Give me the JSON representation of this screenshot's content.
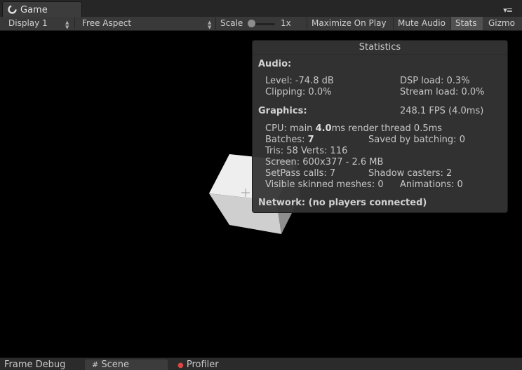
{
  "tab": {
    "icon": "unity-logo-icon",
    "label": "Game"
  },
  "panel_menu": {
    "icon": "panel-menu-icon",
    "glyph": "▾≡"
  },
  "toolbar": {
    "display": "Display 1",
    "aspect": "Free Aspect",
    "scale_label": "Scale",
    "scale_value": "1x",
    "maximize": "Maximize On Play",
    "mute": "Mute Audio",
    "stats": "Stats",
    "gizmos": "Gizmo"
  },
  "stats": {
    "title": "Statistics",
    "audio_header": "Audio:",
    "level": "Level: -74.8 dB",
    "dsp_load": "DSP load: 0.3%",
    "clipping": "Clipping: 0.0%",
    "stream_load": "Stream load: 0.0%",
    "graphics_header": "Graphics:",
    "fps": "248.1 FPS (4.0ms)",
    "cpu_prefix": "CPU: main ",
    "cpu_main": "4.0",
    "cpu_suffix": "ms  render thread 0.5ms",
    "batches_prefix": "Batches: ",
    "batches": "7",
    "saved_batching": "Saved by batching: 0",
    "tris_verts": "Tris: 58   Verts: 116",
    "screen": "Screen: 600x377 - 2.6 MB",
    "setpass": "SetPass calls: 7",
    "shadow_casters": "Shadow casters: 2",
    "skinned_meshes": "Visible skinned meshes: 0",
    "animations": "Animations: 0",
    "network": "Network: (no players connected)"
  },
  "bottom_tabs": {
    "frame_debug": "Frame Debug",
    "scene": "Scene",
    "profiler": "Profiler"
  }
}
